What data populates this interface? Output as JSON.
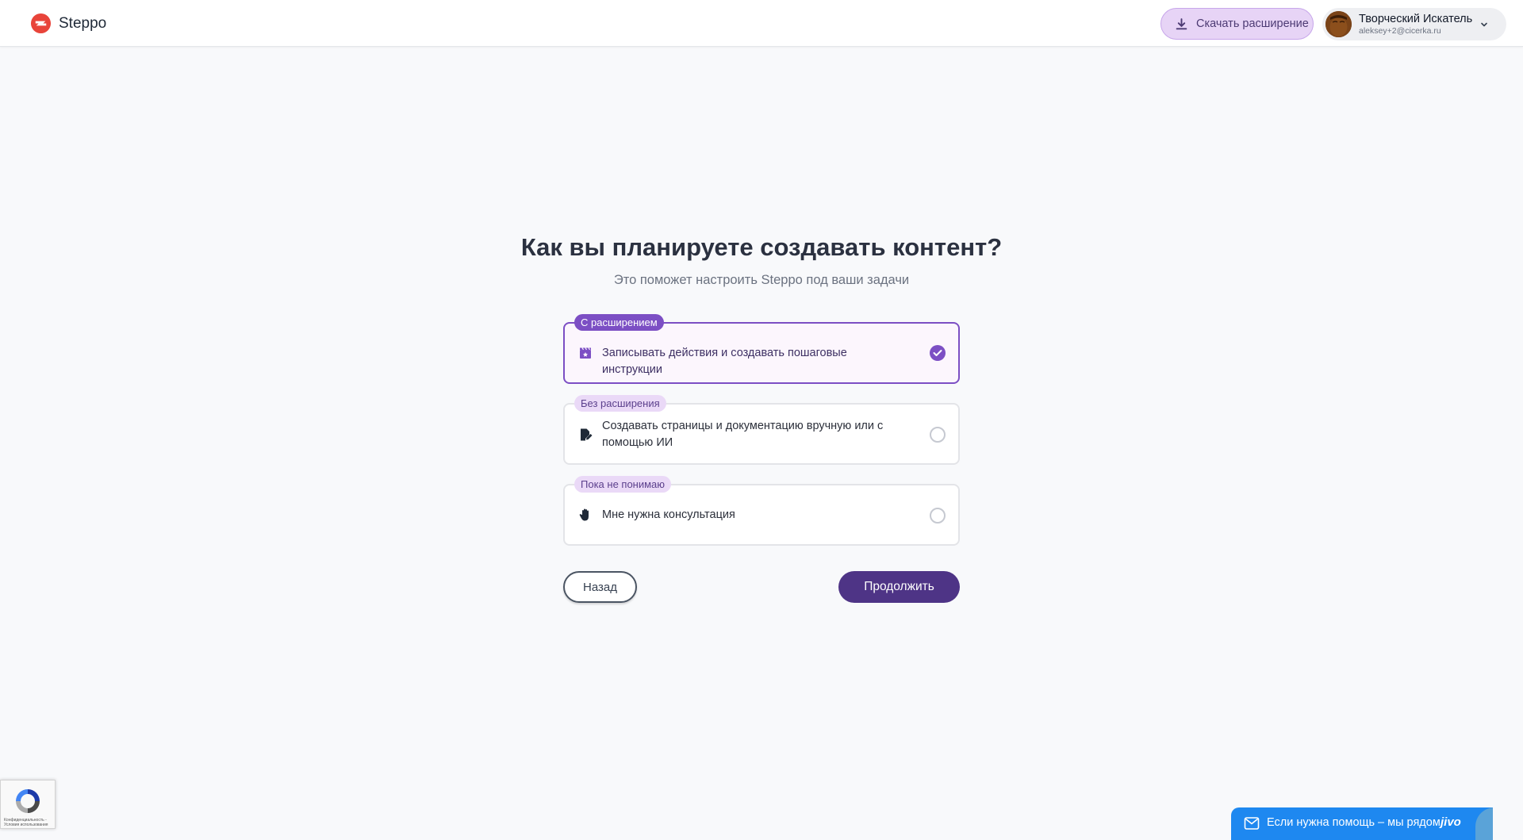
{
  "header": {
    "brand": "Steppo",
    "download_button": "Скачать расширение",
    "user": {
      "name": "Творческий Искатель",
      "email": "aleksey+2@cicerka.ru"
    }
  },
  "main": {
    "title": "Как вы планируете создавать контент?",
    "subtitle": "Это поможет настроить Steppo под ваши задачи",
    "options": [
      {
        "badge": "С расширением",
        "label": "Записывать действия и создавать пошаговые инструкции",
        "icon": "clapperboard-icon",
        "selected": true
      },
      {
        "badge": "Без расширения",
        "label": "Создавать страницы и документацию вручную или с помощью ИИ",
        "icon": "edit-document-icon",
        "selected": false
      },
      {
        "badge": "Пока не понимаю",
        "label": "Мне нужна консультация",
        "icon": "hand-icon",
        "selected": false
      }
    ],
    "back_button": "Назад",
    "continue_button": "Продолжить"
  },
  "recaptcha": {
    "text": "Конфиденциальность - Условия использования"
  },
  "chat_widget": {
    "text": "Если нужна помощь – мы рядом",
    "logo": "jivo"
  },
  "colors": {
    "accent": "#7c4fc4",
    "primary_button": "#4e3486",
    "logo": "#e8443a",
    "chat": "#1e88f0"
  }
}
